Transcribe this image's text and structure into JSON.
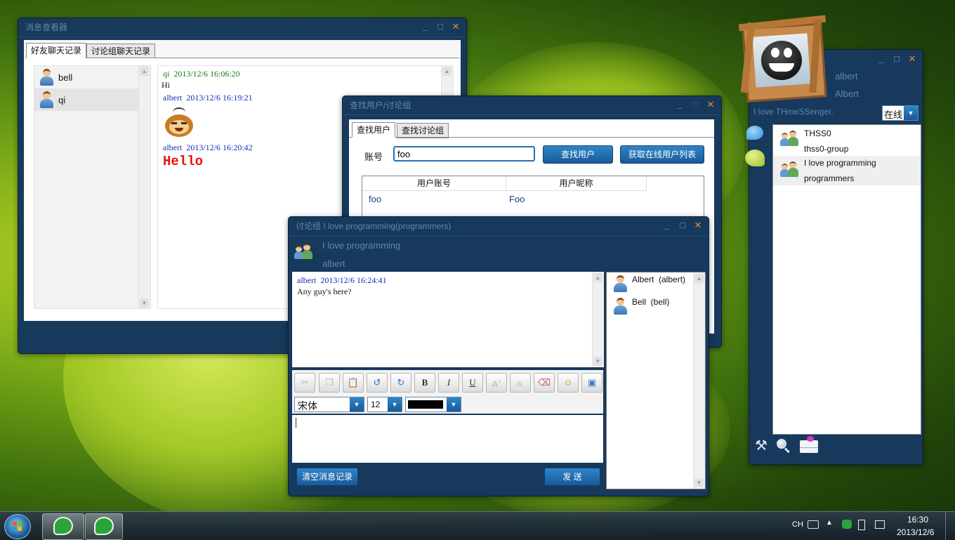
{
  "viewer": {
    "title": "消息查看器",
    "tabs": [
      "好友聊天记录",
      "讨论组聊天记录"
    ],
    "friends": [
      "bell",
      "qi"
    ],
    "messages": [
      {
        "sender": "qi",
        "time": "2013/12/6 16:06:20",
        "text": "Hi"
      },
      {
        "sender": "albert",
        "time": "2013/12/6 16:19:21",
        "text": ""
      },
      {
        "sender": "albert",
        "time": "2013/12/6 16:20:42",
        "text": "Hello"
      }
    ]
  },
  "search": {
    "title": "查找用户/讨论组",
    "tabs": [
      "查找用户",
      "查找讨论组"
    ],
    "account_label": "账号",
    "account_value": "foo",
    "find_button": "查找用户",
    "online_button": "获取在线用户列表",
    "columns": [
      "用户账号",
      "用户昵称"
    ],
    "rows": [
      [
        "foo",
        "Foo"
      ]
    ]
  },
  "group_chat": {
    "title": "讨论组 I love programming(programmers)",
    "group_name": "I love programming",
    "owner": "albert",
    "message": {
      "sender": "albert",
      "time": "2013/12/6 16:24:41",
      "text": "Any guy's here?"
    },
    "font_name": "宋体",
    "font_size": "12",
    "clear_button": "清空消息记录",
    "send_button": "发 送",
    "members": [
      "Albert  (albert)",
      "Bell  (bell)"
    ]
  },
  "main_panel": {
    "account": "albert",
    "nickname": "Albert",
    "signature": "I love THmeSSenger.",
    "status": "在线",
    "contacts": [
      {
        "name": "THSS0",
        "sub": "thss0-group"
      },
      {
        "name": "I love programming",
        "sub": "programmers"
      }
    ]
  },
  "taskbar": {
    "lang": "CH",
    "time": "16:30",
    "date": "2013/12/6"
  },
  "colors": {
    "window_bg": "#17395c",
    "title_text": "#5f86ac",
    "accent_button": "#2475b8",
    "close_button": "#e8892c",
    "sender_friend": "#1a7a1a",
    "sender_self": "#1a2ab5",
    "hello_red": "#e81010"
  }
}
